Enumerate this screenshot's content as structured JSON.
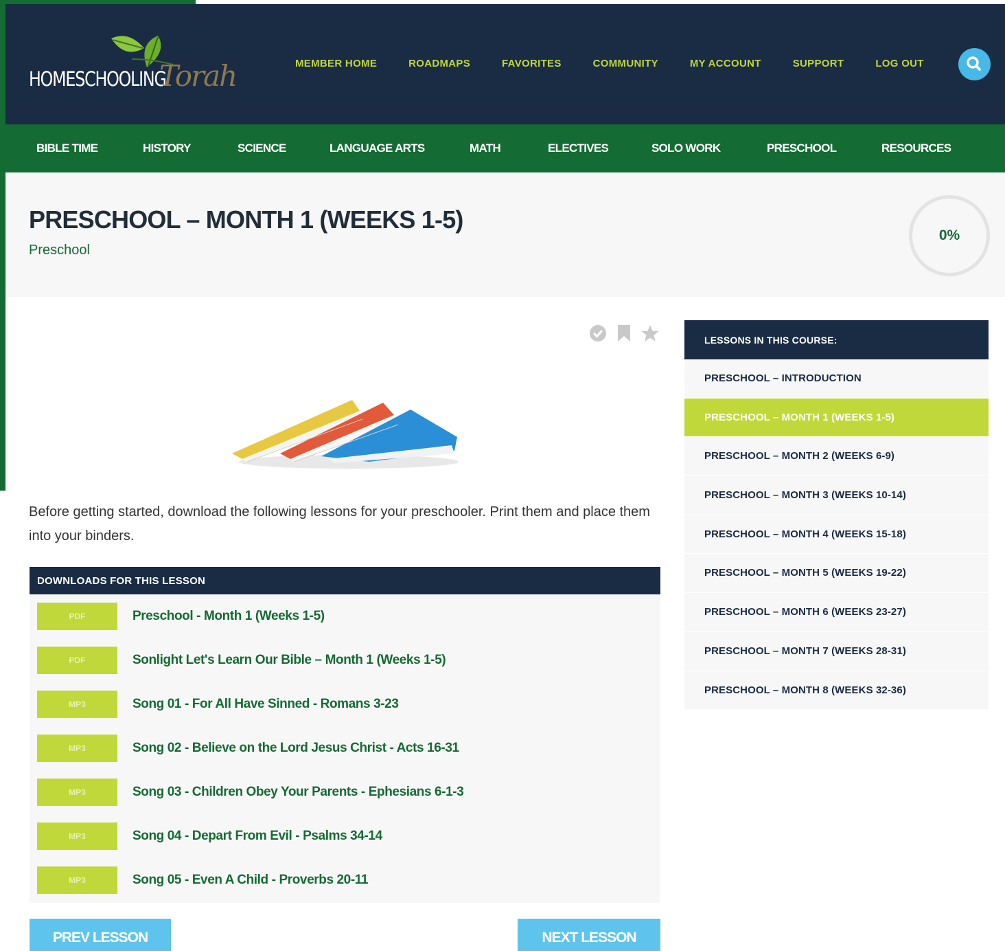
{
  "brand": {
    "logo_text": "HOMESCHOOLING",
    "logo_script": "Torah"
  },
  "main_nav": [
    "MEMBER HOME",
    "ROADMAPS",
    "FAVORITES",
    "COMMUNITY",
    "MY ACCOUNT",
    "SUPPORT",
    "LOG OUT"
  ],
  "search": {
    "icon": "search-icon"
  },
  "sub_nav": [
    "BIBLE TIME",
    "HISTORY",
    "SCIENCE",
    "LANGUAGE ARTS",
    "MATH",
    "ELECTIVES",
    "SOLO WORK",
    "PRESCHOOL",
    "RESOURCES"
  ],
  "page": {
    "title": "PRESCHOOL – MONTH 1 (WEEKS 1-5)",
    "category": "Preschool",
    "progress_label": "0%",
    "progress": 0
  },
  "lesson_actions": [
    "check-circle-icon",
    "bookmark-icon",
    "star-icon"
  ],
  "intro_text": "Before getting started, download the following lessons for your preschooler. Print them and place them into your binders.",
  "downloads": {
    "heading": "DOWNLOADS FOR THIS LESSON",
    "items": [
      {
        "type": "PDF",
        "title": "Preschool - Month 1 (Weeks 1-5)"
      },
      {
        "type": "PDF",
        "title": "Sonlight Let's Learn Our Bible – Month 1 (Weeks 1-5)"
      },
      {
        "type": "MP3",
        "title": "Song 01 - For All Have Sinned - Romans 3-23"
      },
      {
        "type": "MP3",
        "title": "Song 02 - Believe on the Lord Jesus Christ - Acts 16-31"
      },
      {
        "type": "MP3",
        "title": "Song 03 - Children Obey Your Parents - Ephesians 6-1-3"
      },
      {
        "type": "MP3",
        "title": "Song 04 - Depart From Evil - Psalms 34-14"
      },
      {
        "type": "MP3",
        "title": "Song 05 - Even A Child - Proverbs 20-11"
      }
    ]
  },
  "nav_buttons": {
    "prev": "PREV LESSON",
    "next": "NEXT LESSON"
  },
  "sidebar": {
    "heading": "LESSONS IN THIS COURSE:",
    "items": [
      "PRESCHOOL – INTRODUCTION",
      "PRESCHOOL – MONTH 1 (WEEKS 1-5)",
      "PRESCHOOL – MONTH 2 (WEEKS 6-9)",
      "PRESCHOOL – MONTH 3 (WEEKS 10-14)",
      "PRESCHOOL – MONTH 4 (WEEKS 15-18)",
      "PRESCHOOL – MONTH 5 (WEEKS 19-22)",
      "PRESCHOOL – MONTH 6 (WEEKS 23-27)",
      "PRESCHOOL – MONTH 7 (WEEKS 28-31)",
      "PRESCHOOL – MONTH 8 (WEEKS 32-36)"
    ],
    "active_index": 1
  },
  "colors": {
    "navy": "#1a2b44",
    "green": "#146b33",
    "lime": "#c0d83a",
    "sky": "#5fc4ed"
  }
}
